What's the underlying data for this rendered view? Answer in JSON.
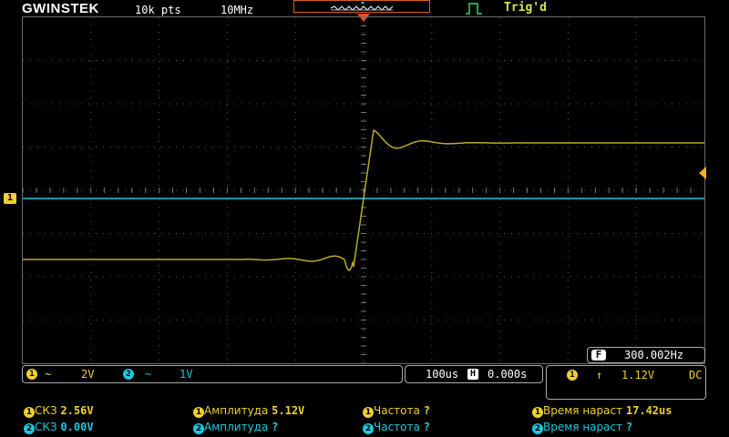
{
  "header": {
    "brand": "GWINSTEK",
    "memory_depth": "10k pts",
    "sample_rate": "10MHz",
    "trigger_status": "Trig'd"
  },
  "channel_markers": {
    "ch1_label": "1"
  },
  "frequency_counter": {
    "badge": "F",
    "value": "300.002Hz"
  },
  "channel_settings": {
    "ch1": {
      "id": "1",
      "coupling_symbol": "~",
      "scale": "2V"
    },
    "ch2": {
      "id": "2",
      "coupling_symbol": "~",
      "scale": "1V"
    }
  },
  "timebase": {
    "scale": "100us",
    "h_badge": "H",
    "position": "0.000s"
  },
  "trigger": {
    "source": "1",
    "slope_symbol": "↑",
    "level": "1.12V",
    "coupling": "DC"
  },
  "measurements": {
    "row1": [
      {
        "ch": "1",
        "label": "СКЗ",
        "value": "2.56V"
      },
      {
        "ch": "1",
        "label": "Амплитуда",
        "value": "5.12V"
      },
      {
        "ch": "1",
        "label": "Частота",
        "value": "?"
      },
      {
        "ch": "1",
        "label": "Время нараст",
        "value": "17.42us"
      }
    ],
    "row2": [
      {
        "ch": "2",
        "label": "СКЗ",
        "value": "0.00V"
      },
      {
        "ch": "2",
        "label": "Амплитуда",
        "value": "?"
      },
      {
        "ch": "2",
        "label": "Частота",
        "value": "?"
      },
      {
        "ch": "2",
        "label": "Время нараст",
        "value": "?"
      }
    ]
  },
  "colors": {
    "ch1": "#f0d030",
    "ch1_trace": "#b8ac28",
    "ch2": "#20c8e0",
    "trigger_marker": "#f2b416",
    "position_arrow": "#ff4d1a"
  }
}
